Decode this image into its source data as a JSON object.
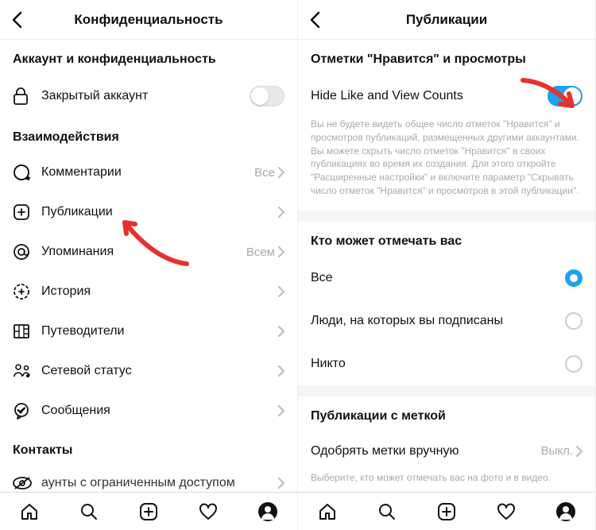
{
  "accent": "#1da1f2",
  "left": {
    "title": "Конфиденциальность",
    "section1": "Аккаунт и конфиденциальность",
    "private_account": "Закрытый аккаунт",
    "section2": "Взаимодействия",
    "items": [
      {
        "label": "Комментарии",
        "meta": "Все"
      },
      {
        "label": "Публикации",
        "meta": ""
      },
      {
        "label": "Упоминания",
        "meta": "Всем"
      },
      {
        "label": "История",
        "meta": ""
      },
      {
        "label": "Путеводители",
        "meta": ""
      },
      {
        "label": "Сетевой статус",
        "meta": ""
      },
      {
        "label": "Сообщения",
        "meta": ""
      }
    ],
    "section3": "Контакты",
    "restricted": "аунты с ограниченным доступом"
  },
  "right": {
    "title": "Публикации",
    "section1": "Отметки \"Нравится\" и просмотры",
    "hide_counts": "Hide Like and View Counts",
    "help1": "Вы не будете видеть общее число отметок \"Нравится\" и просмотров публикаций, размещенных другими аккаунтами. Вы можете скрыть число отметок \"Нравится\" в своих публикациях во время их создания. Для этого откройте \"Расширенные настройки\" и включите параметр \"Скрывать число отметок \"Нравится\" и просмотров в этой публикации\".",
    "section2": "Кто может отмечать вас",
    "radios": [
      {
        "label": "Все",
        "selected": true
      },
      {
        "label": "Люди, на которых вы подписаны",
        "selected": false
      },
      {
        "label": "Никто",
        "selected": false
      }
    ],
    "section3": "Публикации с меткой",
    "approve_manually": "Одобрять метки вручную",
    "approve_value": "Выкл.",
    "help2": "Выберите, кто может отмечать вас на фото и в видео."
  }
}
